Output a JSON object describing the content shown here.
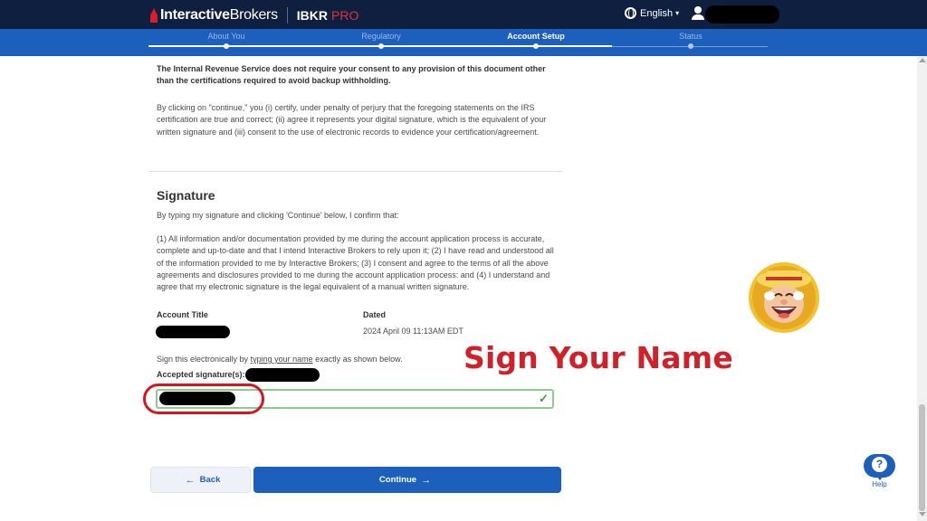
{
  "header": {
    "brand_bold": "Interactive",
    "brand_light": "Brokers",
    "product": "IBKR",
    "product_suffix": "PRO",
    "language": "English",
    "language_caret": "▾",
    "user_icon": "user-icon",
    "globe_icon": "globe-icon"
  },
  "steps": [
    {
      "label": "About You",
      "state": "done"
    },
    {
      "label": "Regulatory",
      "state": "done"
    },
    {
      "label": "Account Setup",
      "state": "active"
    },
    {
      "label": "Status",
      "state": "pending"
    }
  ],
  "content": {
    "irs_notice": "The Internal Revenue Service does not require your consent to any provision of this document other than the certifications required to avoid backup withholding.",
    "consent_text": "By clicking on \"continue,\" you (i) certify, under penalty of perjury that the foregoing statements on the IRS certification are true and correct; (ii) agree it represents your digital signature, which is the equivalent of your written signature and (iii) consent to the use of electronic records to evidence your certification/agreement.",
    "signature_heading": "Signature",
    "signature_intro": "By typing my signature and clicking 'Continue' below, I confirm that:",
    "signature_terms": "(1) All information and/or documentation provided by me during the account application process is accurate, complete and up-to-date and that I intend Interactive Brokers to rely upon it; (2) I have read and understood all of the information provided to me by Interactive Brokers; (3) I consent and agree to the terms of all the above agreements and disclosures provided to me during the account application process: and (4) I understand and agree that my electronic signature is the legal equivalent of a manual written signature.",
    "account_title_label": "Account Title",
    "dated_label": "Dated",
    "dated_value": "2024 April 09 11:13AM EDT",
    "sign_prefix": "Sign this electronically by ",
    "sign_link": "typing your name",
    "sign_suffix": " exactly as shown below.",
    "accepted_label": "Accepted signature(s):",
    "valid_icon": "check-icon",
    "valid_glyph": "✓"
  },
  "annotation": {
    "text": "Sign Your Name",
    "color": "#d31f27"
  },
  "buttons": {
    "back": "Back",
    "back_arrow": "←",
    "continue": "Continue",
    "continue_arrow": "→"
  },
  "help": {
    "glyph": "?",
    "label": "Help"
  },
  "colors": {
    "topbar": "#0e1f3f",
    "primary": "#1d5fbd",
    "accent_red": "#d81e2c",
    "valid_green": "#38a03c"
  }
}
